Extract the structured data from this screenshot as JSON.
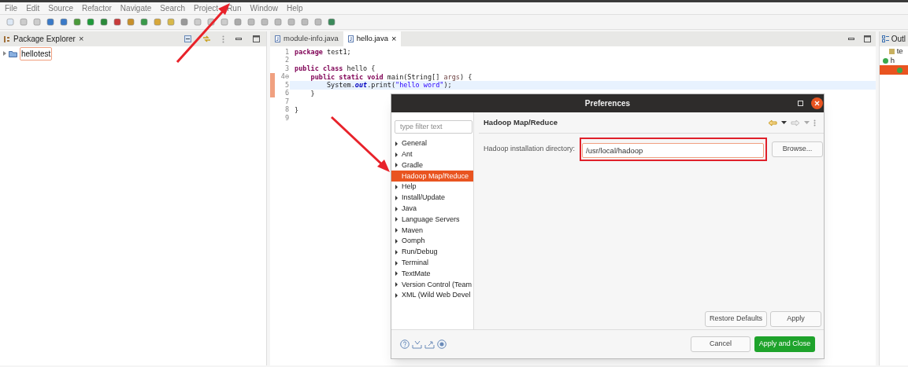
{
  "menu": [
    "File",
    "Edit",
    "Source",
    "Refactor",
    "Navigate",
    "Search",
    "Project",
    "Run",
    "Window",
    "Help"
  ],
  "package_explorer": {
    "title": "Package Explorer",
    "close": "×",
    "items": [
      {
        "label": "hellotest",
        "selected": true
      }
    ]
  },
  "editor": {
    "tabs": [
      {
        "label": "module-info.java",
        "selected": false
      },
      {
        "label": "hello.java",
        "selected": true,
        "close": "×"
      }
    ],
    "lines": [
      {
        "number": "1",
        "marked": false,
        "current": false,
        "tokens": [
          {
            "kind": "kw",
            "text": "package"
          },
          {
            "kind": "plain",
            "text": " test1;"
          }
        ]
      },
      {
        "number": "2",
        "marked": false,
        "current": false
      },
      {
        "number": "3",
        "marked": false,
        "current": false,
        "tokens": [
          {
            "kind": "kw",
            "text": "public class"
          },
          {
            "kind": "plain",
            "text": " hello {"
          }
        ]
      },
      {
        "number": "4⊖",
        "marked": true,
        "current": false,
        "tokens": [
          {
            "kind": "kw",
            "text": "    public static void"
          },
          {
            "kind": "plain",
            "text": " main(String[] "
          },
          {
            "kind": "param",
            "text": "args"
          },
          {
            "kind": "plain",
            "text": ") {"
          }
        ]
      },
      {
        "number": "5",
        "marked": true,
        "current": true,
        "tokens": [
          {
            "kind": "plain",
            "text": "        System."
          },
          {
            "kind": "field",
            "text": "out"
          },
          {
            "kind": "plain",
            "text": ".print("
          },
          {
            "kind": "str",
            "text": "\"hello word\""
          },
          {
            "kind": "plain",
            "text": ");"
          }
        ]
      },
      {
        "number": "6",
        "marked": true,
        "current": false,
        "tokens": [
          {
            "kind": "plain",
            "text": "    }"
          }
        ]
      },
      {
        "number": "7",
        "marked": false,
        "current": false
      },
      {
        "number": "8",
        "marked": false,
        "current": false,
        "tokens": [
          {
            "kind": "plain",
            "text": "}"
          }
        ]
      },
      {
        "number": "9",
        "marked": false,
        "current": false
      }
    ]
  },
  "outline": {
    "title": "Outl",
    "items": [
      {
        "label": "te",
        "selected": false
      },
      {
        "label": "h",
        "selected": false
      },
      {
        "selected": true
      }
    ]
  },
  "dialog": {
    "title": "Preferences",
    "filter": {
      "placeholder": "type filter text"
    },
    "tree": [
      {
        "label": "General",
        "selected": false,
        "expandable": true
      },
      {
        "label": "Ant",
        "selected": false,
        "expandable": true
      },
      {
        "label": "Gradle",
        "selected": false,
        "expandable": true
      },
      {
        "label": "Hadoop Map/Reduce",
        "selected": true,
        "expandable": false
      },
      {
        "label": "Help",
        "selected": false,
        "expandable": true
      },
      {
        "label": "Install/Update",
        "selected": false,
        "expandable": true
      },
      {
        "label": "Java",
        "selected": false,
        "expandable": true
      },
      {
        "label": "Language Servers",
        "selected": false,
        "expandable": true
      },
      {
        "label": "Maven",
        "selected": false,
        "expandable": true
      },
      {
        "label": "Oomph",
        "selected": false,
        "expandable": true
      },
      {
        "label": "Run/Debug",
        "selected": false,
        "expandable": true
      },
      {
        "label": "Terminal",
        "selected": false,
        "expandable": true
      },
      {
        "label": "TextMate",
        "selected": false,
        "expandable": true
      },
      {
        "label": "Version Control (Team",
        "selected": false,
        "expandable": true
      },
      {
        "label": "XML (Wild Web Devel",
        "selected": false,
        "expandable": true
      }
    ],
    "page_title": "Hadoop Map/Reduce",
    "field_label": "Hadoop installation directory:",
    "field_value": "/usr/local/hadoop",
    "browse": "Browse...",
    "restore": "Restore Defaults",
    "apply": "Apply",
    "cancel": "Cancel",
    "apply_close": "Apply and Close"
  }
}
